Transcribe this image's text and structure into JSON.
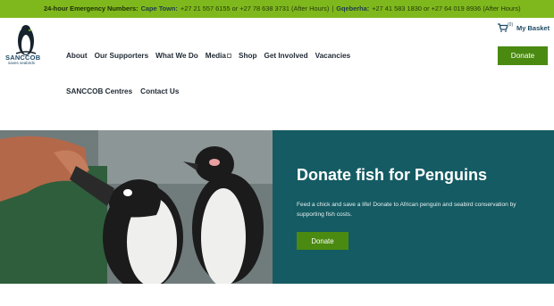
{
  "topbar": {
    "emergency_label": "24-hour Emergency Numbers:",
    "city1": "Cape Town:",
    "city1_numbers": "+27 21 557 6155 or +27 78 638 3731 (After Hours)",
    "separator": "|",
    "city2": "Gqeberha:",
    "city2_numbers": "+27 41 583 1830 or +27 64 019 8936 (After Hours)"
  },
  "logo": {
    "name": "SANCCOB",
    "tagline": "saves seabirds"
  },
  "basket": {
    "count": "(0)",
    "label": "My Basket",
    "icon": "cart-icon"
  },
  "nav": {
    "items": [
      "About",
      "Our Supporters",
      "What We Do",
      "Media",
      "Shop",
      "Get Involved",
      "Vacancies"
    ],
    "row2": [
      "SANCCOB Centres",
      "Contact Us"
    ]
  },
  "donate_button": "Donate",
  "hero": {
    "title": "Donate fish for Penguins",
    "text": "Feed a chick and save a life! Donate to African penguin and seabird conservation by supporting fish costs.",
    "button": "Donate"
  },
  "colors": {
    "topbar": "#7fb81d",
    "accent_green": "#4a8a10",
    "hero_panel": "#155b63",
    "brand_blue": "#1f4a66"
  }
}
